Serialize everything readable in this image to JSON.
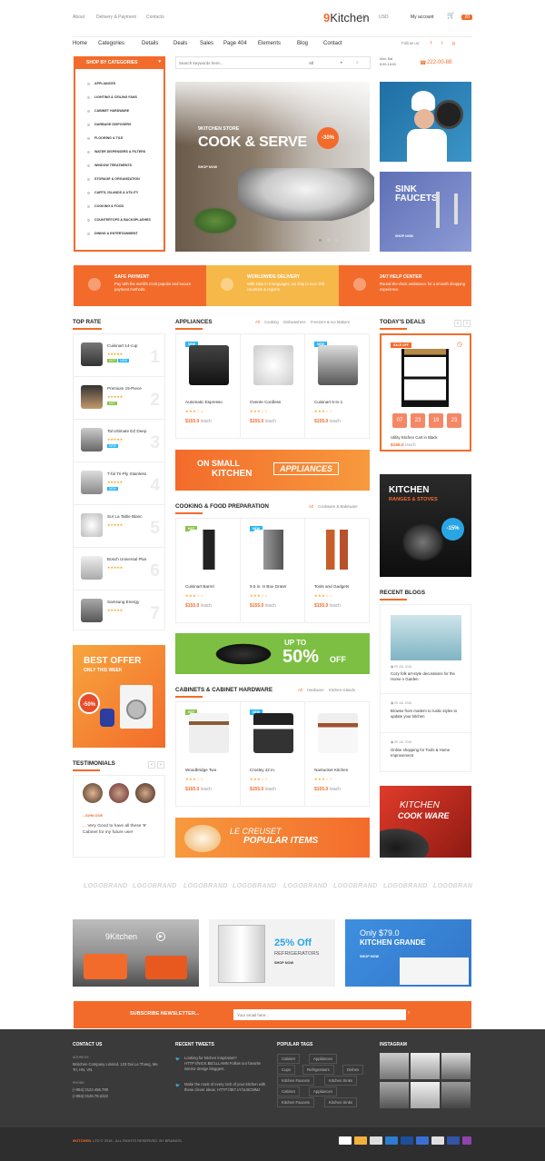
{
  "topbar": {
    "about": "About",
    "delivery": "Delivery & Payment",
    "contacts": "Contacts",
    "lang": "EN",
    "currency": "USD",
    "account": "My account",
    "cart_count": "20"
  },
  "logo": {
    "num": "9",
    "name": "Kitchen"
  },
  "nav": {
    "items": [
      "Home",
      "Categories",
      "Details",
      "Deals",
      "Sales",
      "Page 404",
      "Elements",
      "Blog",
      "Contact"
    ],
    "follow": "Follow us:"
  },
  "sidebar": {
    "title": "SHOP BY CATEGORIES",
    "items": [
      "APPLIANCES",
      "LIGHTING & CEILING FANS",
      "CABINET HARDWARE",
      "GARBAGE DISPOSERS",
      "FLOORING & TILE",
      "WATER DISPENSERS & FILTERS",
      "WINDOW TREATMENTS",
      "STORAGE & ORGANIZATION",
      "CARTS, ISLANDS & UTILITY",
      "COOKING & FOOD",
      "COUNTERTOPS & BACKSPLASHES",
      "DINING & ENTERTAINMENT"
    ]
  },
  "search": {
    "placeholder": "Search keywords here...",
    "category": "All"
  },
  "hours": {
    "label": "Mon-Sat",
    "time": "8:00-18:00",
    "phone": "222-00-88"
  },
  "slider": {
    "kicker": "9KITCHEN STORE",
    "title": "COOK & SERVE",
    "cta": "SHOP NOW",
    "badge": "-30%"
  },
  "right_banner2": {
    "title": "SINK FAUCETS",
    "cta": "SHOP NOW"
  },
  "features": [
    {
      "title": "SAFE PAYMENT",
      "text": "Pay with the world's most popular and secure payment methods."
    },
    {
      "title": "WORLDWIDE DELIVERY",
      "text": "With sites in 5 languages, we ship to over 200 countries & regions."
    },
    {
      "title": "24/7 HELP CENTER",
      "text": "Round-the-clock assistance for a smooth shopping experience."
    }
  ],
  "top_rate": {
    "title": "TOP RATE",
    "items": [
      {
        "name": "Cuisinart 14-cup",
        "num": "1",
        "tags": [
          "HOT",
          "NEW"
        ]
      },
      {
        "name": "Premium 15-Piece",
        "num": "2",
        "tags": [
          "HOT"
        ]
      },
      {
        "name": "Tal Ultimate EZ Deep",
        "num": "3",
        "tags": [
          "NEW"
        ]
      },
      {
        "name": "T-fal Tri-Ply Stainless",
        "num": "4",
        "tags": [
          "NEW"
        ]
      },
      {
        "name": "Sur La Table Blanc",
        "num": "5",
        "tags": []
      },
      {
        "name": "Bosch Universal Plus",
        "num": "6",
        "tags": []
      },
      {
        "name": "Samsung Energy",
        "num": "7",
        "tags": []
      }
    ]
  },
  "appliances": {
    "title": "APPLIANCES",
    "tabs": [
      "All",
      "Cooking",
      "Dishwashers",
      "Freezers & Ice Makers"
    ],
    "products": [
      {
        "name": "Automatic Espresso",
        "price": "$155.0",
        "unit": "/each",
        "badge": "NEW"
      },
      {
        "name": "Ovente Cordless",
        "price": "$155.0",
        "unit": "/each",
        "badge": ""
      },
      {
        "name": "Cuisinart 5-in-1",
        "price": "$155.0",
        "unit": "/each",
        "badge": "NEW"
      }
    ]
  },
  "banner_small": {
    "line1": "ON SMALL",
    "line2": "KITCHEN",
    "line3": "APPLIANCES"
  },
  "cooking": {
    "title": "COOKING & FOOD PREPARATION",
    "tabs": [
      "All",
      "Cookware & Bakeware"
    ],
    "products": [
      {
        "name": "Cuisinart Barrel",
        "price": "$155.0",
        "unit": "/each",
        "badge": "HOT"
      },
      {
        "name": "9.5 in. H Box Grater",
        "price": "$155.0",
        "unit": "/each",
        "badge": "NEW"
      },
      {
        "name": "Tools and Gadgets",
        "price": "$155.0",
        "unit": "/each",
        "badge": ""
      }
    ]
  },
  "banner_50": {
    "line1": "UP TO",
    "line2": "50%",
    "line3": "OFF"
  },
  "cabinets": {
    "title": "CABINETS & CABINET HARDWARE",
    "tabs": [
      "All",
      "Hardware",
      "Kitchen Islands"
    ],
    "products": [
      {
        "name": "Woodbridge Two",
        "price": "$155.0",
        "unit": "/each",
        "badge": "HOT"
      },
      {
        "name": "Crosley 42 in.",
        "price": "$155.0",
        "unit": "/each",
        "badge": "NEW"
      },
      {
        "name": "Nantucket Kitchen",
        "price": "$155.0",
        "unit": "/each",
        "badge": ""
      }
    ]
  },
  "banner_creuset": {
    "line1": "LE CREUSET",
    "line2": "POPULAR ITEMS"
  },
  "deals": {
    "title": "TODAY'S DEALS",
    "badge": "SALE OFF",
    "countdown": [
      "07",
      "23",
      "19",
      "23"
    ],
    "name": "Utility Kitchen Cart in Black",
    "price": "$155.0",
    "unit": "/each"
  },
  "ranges": {
    "line1": "KITCHEN",
    "line2": "RANGES & STOVES",
    "badge": "-15%"
  },
  "blogs": {
    "title": "RECENT BLOGS",
    "items": [
      {
        "date": "09 JUL 2016",
        "text": "Cozy folk art-style decorations for the Home n Garden"
      },
      {
        "date": "09 JUL 2016",
        "text": "Browse from modern to rustic styles to update your kitchen"
      },
      {
        "date": "09 JUL 2016",
        "text": "Online shopping for Tools & Home Improvement"
      }
    ]
  },
  "best_offer": {
    "line1": "BEST OFFER",
    "line2": "ONLY THIS WEEK",
    "badge": "-50%"
  },
  "testimonials": {
    "title": "TESTIMONIALS",
    "name": "- JOHN DOE",
    "quote": "... Very Good to have all these '9' Cabinet for my future use!"
  },
  "cookware": {
    "line1": "KITCHEN",
    "line2": "COOK WARE"
  },
  "logos": [
    "LOGOBRAND",
    "LOGOBRAND",
    "LOGOBRAND",
    "LOGOBRAND",
    "LOGOBRAND",
    "LOGOBRAND",
    "LOGOBRAND",
    "LOGOBRAND"
  ],
  "promos": {
    "p1": "9Kitchen",
    "p2_pct": "25% Off",
    "p2_sub": "REFRIGERATORS",
    "p2_cta": "SHOP NOW",
    "p3_price": "Only $79.0",
    "p3_title": "KITCHEN GRANDE",
    "p3_cta": "SHOP NOW"
  },
  "newsletter": {
    "title": "SUBSCRIBE NEWSLETTER...",
    "placeholder": "Your email here..."
  },
  "footer": {
    "contact_title": "CONTACT US",
    "address_label": "ADDRESS:",
    "address": "9Kitchen Company Limited. 123 Dai La Thang, Me Tri, HN, VN.",
    "phone_label": "PHONE:",
    "phone1": "(+084) 0123.456.789",
    "phone2": "(+084) 0126.78.2222",
    "tweets_title": "RECENT TWEETS",
    "tweet1": "Looking for kitchen inspiration? HTTP://NICK.BE/1LLAMN Follow our favorite interior design bloggers.",
    "tweet2": "Make the most of every inch of your kitchen with these clever ideas. HTTP://BIT.LY/1LBCMMJ",
    "tags_title": "POPULAR TAGS",
    "tags": [
      "Cabinet",
      "Appliances",
      "Cups",
      "Refrigerators",
      "Dishes",
      "Kitchen Faucets",
      "Kitchen Sinks",
      "Cabinet",
      "Appliances",
      "Kitchen Faucets",
      "Kitchen Sinks"
    ],
    "instagram_title": "INSTAGRAM"
  },
  "copyright": {
    "brand": "9KITCHEN",
    "rest": ", LTD © 2016 - ALL RIGHTS RESERVED. BY BRAINOS."
  },
  "colors": {
    "accent": "#f36b2b",
    "footer": "#3a3a3a"
  }
}
